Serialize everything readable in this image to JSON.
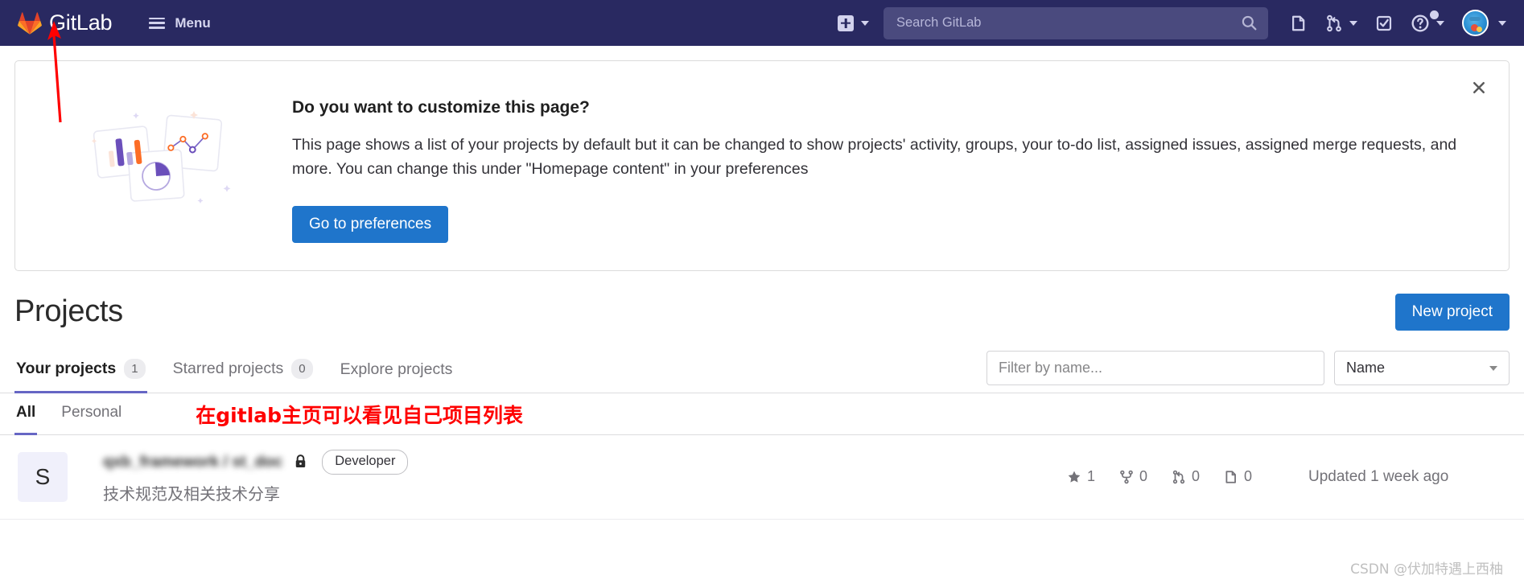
{
  "navbar": {
    "brand": "GitLab",
    "menu_label": "Menu",
    "logo_icon": "gitlab-tanuki-logo",
    "hamburger_icon": "hamburger-menu-icon",
    "create_icon": "plus-square-icon",
    "create_chevron_icon": "chevron-down-icon",
    "search": {
      "placeholder": "Search GitLab",
      "value": "",
      "icon": "search-icon"
    },
    "icons": [
      {
        "name": "issues-icon",
        "label": "Issues"
      },
      {
        "name": "merge-requests-icon",
        "label": "Merge requests"
      },
      {
        "name": "todos-icon",
        "label": "To-Do List"
      },
      {
        "name": "help-icon",
        "label": "Help"
      },
      {
        "name": "user-avatar",
        "label": "User menu"
      }
    ],
    "bg_color": "#292961",
    "search_bg_color": "#4a4a7e"
  },
  "banner": {
    "title": "Do you want to customize this page?",
    "body": "This page shows a list of your projects by default but it can be changed to show projects' activity, groups, your to-do list, assigned issues, assigned merge requests, and more. You can change this under \"Homepage content\" in your preferences",
    "cta_label": "Go to preferences",
    "close_icon": "close-icon",
    "illustration_icon": "charts-cards-illustration",
    "cta_color": "#1f75cb"
  },
  "page": {
    "title": "Projects",
    "new_project_label": "New project"
  },
  "tabs": [
    {
      "label": "Your projects",
      "count": "1",
      "active": true
    },
    {
      "label": "Starred projects",
      "count": "0",
      "active": false
    },
    {
      "label": "Explore projects",
      "count": "",
      "active": false
    }
  ],
  "filter": {
    "placeholder": "Filter by name...",
    "value": "",
    "sort_value": "Name",
    "sort_chevron_icon": "chevron-down-icon"
  },
  "subtabs": [
    {
      "label": "All",
      "active": true
    },
    {
      "label": "Personal",
      "active": false
    }
  ],
  "annotations": {
    "red_text": "在gitlab主页可以看见自己项目列表",
    "red_arrow_icon": "red-arrow-up-icon",
    "color": "#ff0000"
  },
  "projects": [
    {
      "avatar_letter": "S",
      "name": "qxb_framework / st_doc",
      "visibility_icon": "lock-icon",
      "role": "Developer",
      "description": "技术规范及相关技术分享",
      "stats": [
        {
          "icon": "star-icon",
          "value": "1"
        },
        {
          "icon": "fork-icon",
          "value": "0"
        },
        {
          "icon": "merge-request-icon",
          "value": "0"
        },
        {
          "icon": "issue-icon",
          "value": "0"
        }
      ],
      "updated": "Updated 1 week ago"
    }
  ],
  "watermark": "CSDN @伏加特遇上西柚"
}
